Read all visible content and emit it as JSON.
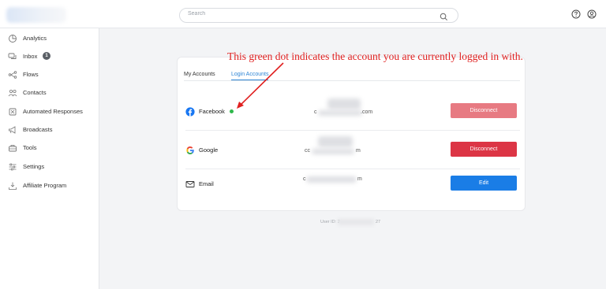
{
  "search": {
    "placeholder": "Search"
  },
  "sidebar": {
    "items": [
      {
        "label": "Analytics",
        "icon": "analytics-icon"
      },
      {
        "label": "Inbox",
        "icon": "inbox-icon",
        "badge": "1"
      },
      {
        "label": "Flows",
        "icon": "flows-icon"
      },
      {
        "label": "Contacts",
        "icon": "contacts-icon"
      },
      {
        "label": "Automated Responses",
        "icon": "automated-responses-icon"
      },
      {
        "label": "Broadcasts",
        "icon": "broadcasts-icon"
      },
      {
        "label": "Tools",
        "icon": "tools-icon"
      },
      {
        "label": "Settings",
        "icon": "settings-icon"
      },
      {
        "label": "Affiliate Program",
        "icon": "affiliate-icon"
      }
    ]
  },
  "tabs": {
    "my_accounts": "My Accounts",
    "login_accounts": "Login Accounts"
  },
  "accounts": [
    {
      "name": "Facebook",
      "id_start": "c",
      "id_end": ".com",
      "action": "Disconnect",
      "active": true
    },
    {
      "name": "Google",
      "id_start": "cc",
      "id_end": "m",
      "action": "Disconnect",
      "active": false
    },
    {
      "name": "Email",
      "id_start": "c",
      "id_end": "m",
      "action": "Edit",
      "active": false
    }
  ],
  "footer": {
    "user_id_label": "User ID: 2",
    "user_id_end": "27"
  },
  "annotation": {
    "text": "This green dot indicates the account you are currently logged in with."
  },
  "colors": {
    "accent": "#2f86d6",
    "danger": "#dc3545",
    "danger_light": "#e77a82",
    "primary": "#1a7de6",
    "green": "#2fb84c",
    "annotation": "#e02020"
  }
}
